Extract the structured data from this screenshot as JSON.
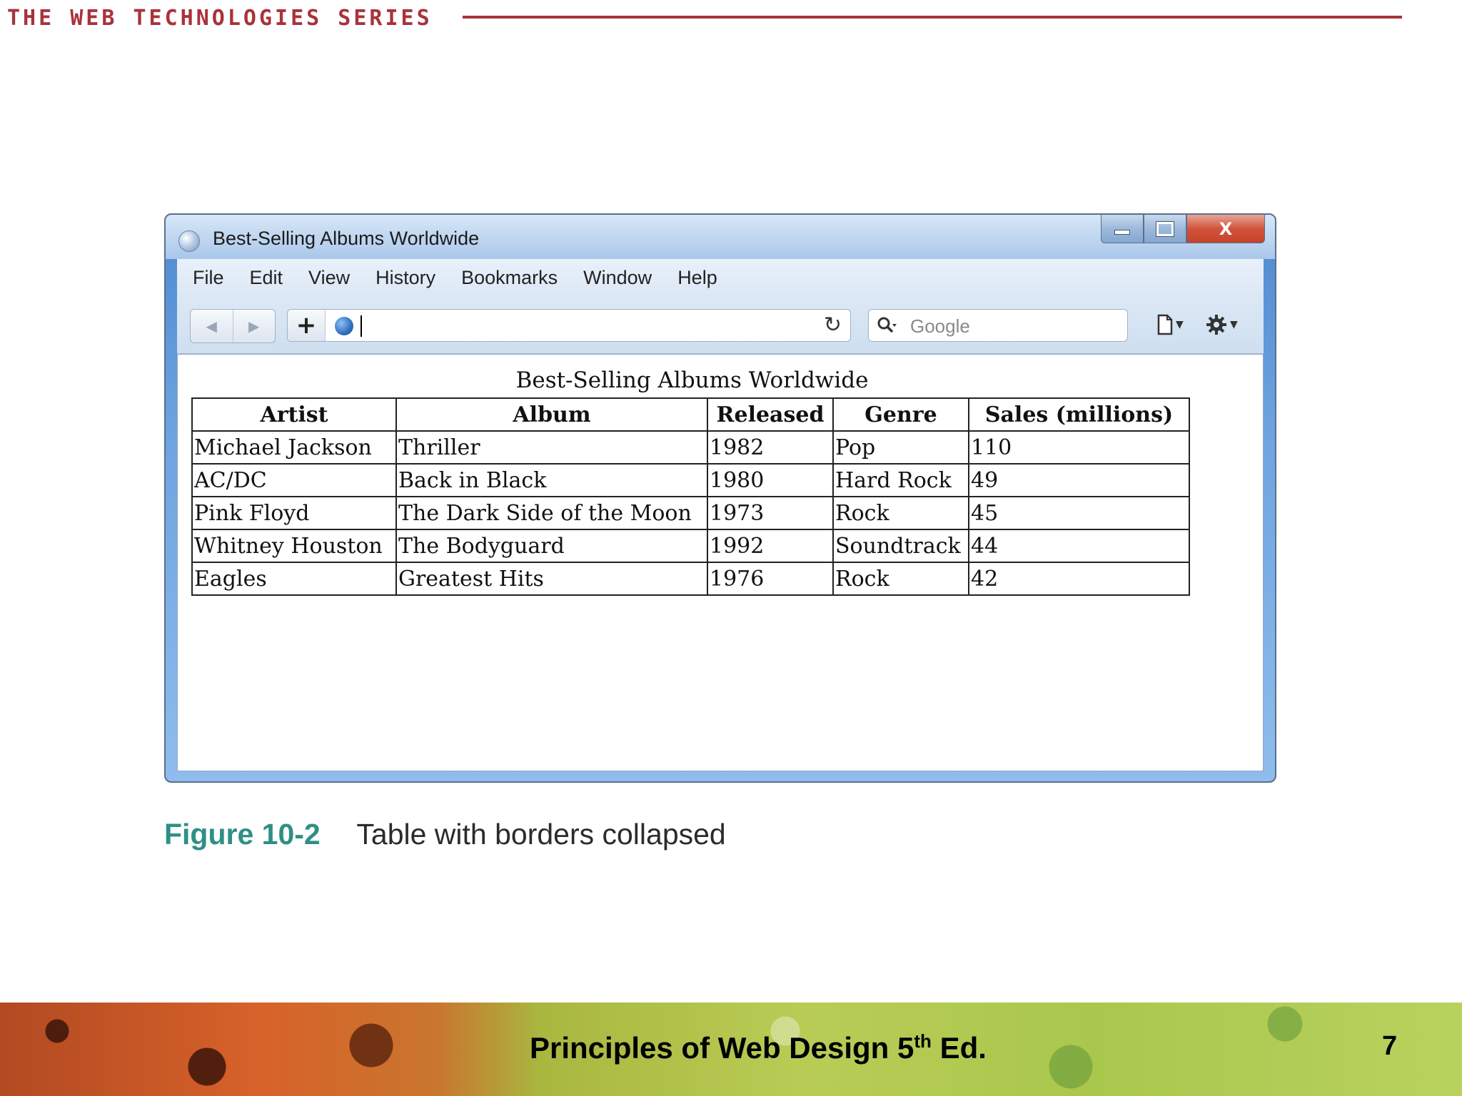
{
  "slide": {
    "series_label": "THE WEB TECHNOLOGIES SERIES",
    "figure_number": "Figure 10-2",
    "figure_text": "Table with borders collapsed",
    "footer_title_main": "Principles of Web Design 5",
    "footer_title_sup": "th",
    "footer_title_tail": " Ed.",
    "page_number": "7",
    "colors": {
      "series": "#a9323b",
      "figure_number": "#2f8f86"
    }
  },
  "browser": {
    "window_title": "Best-Selling Albums Worldwide",
    "caption_buttons": {
      "minimize_icon": "minimize-icon",
      "maximize_icon": "maximize-icon",
      "close_label": "X"
    },
    "menu": [
      "File",
      "Edit",
      "View",
      "History",
      "Bookmarks",
      "Window",
      "Help"
    ],
    "toolbar": {
      "back_icon": "◀",
      "forward_icon": "▶",
      "new_tab_icon": "+",
      "reload_icon": "↻",
      "address_value": "",
      "search_placeholder": "Google"
    }
  },
  "page": {
    "table_caption": "Best-Selling Albums Worldwide",
    "headers": [
      "Artist",
      "Album",
      "Released",
      "Genre",
      "Sales (millions)"
    ],
    "rows": [
      [
        "Michael Jackson",
        "Thriller",
        "1982",
        "Pop",
        "110"
      ],
      [
        "AC/DC",
        "Back in Black",
        "1980",
        "Hard Rock",
        "49"
      ],
      [
        "Pink Floyd",
        "The Dark Side of the Moon",
        "1973",
        "Rock",
        "45"
      ],
      [
        "Whitney Houston",
        "The Bodyguard",
        "1992",
        "Soundtrack",
        "44"
      ],
      [
        "Eagles",
        "Greatest Hits",
        "1976",
        "Rock",
        "42"
      ]
    ]
  }
}
